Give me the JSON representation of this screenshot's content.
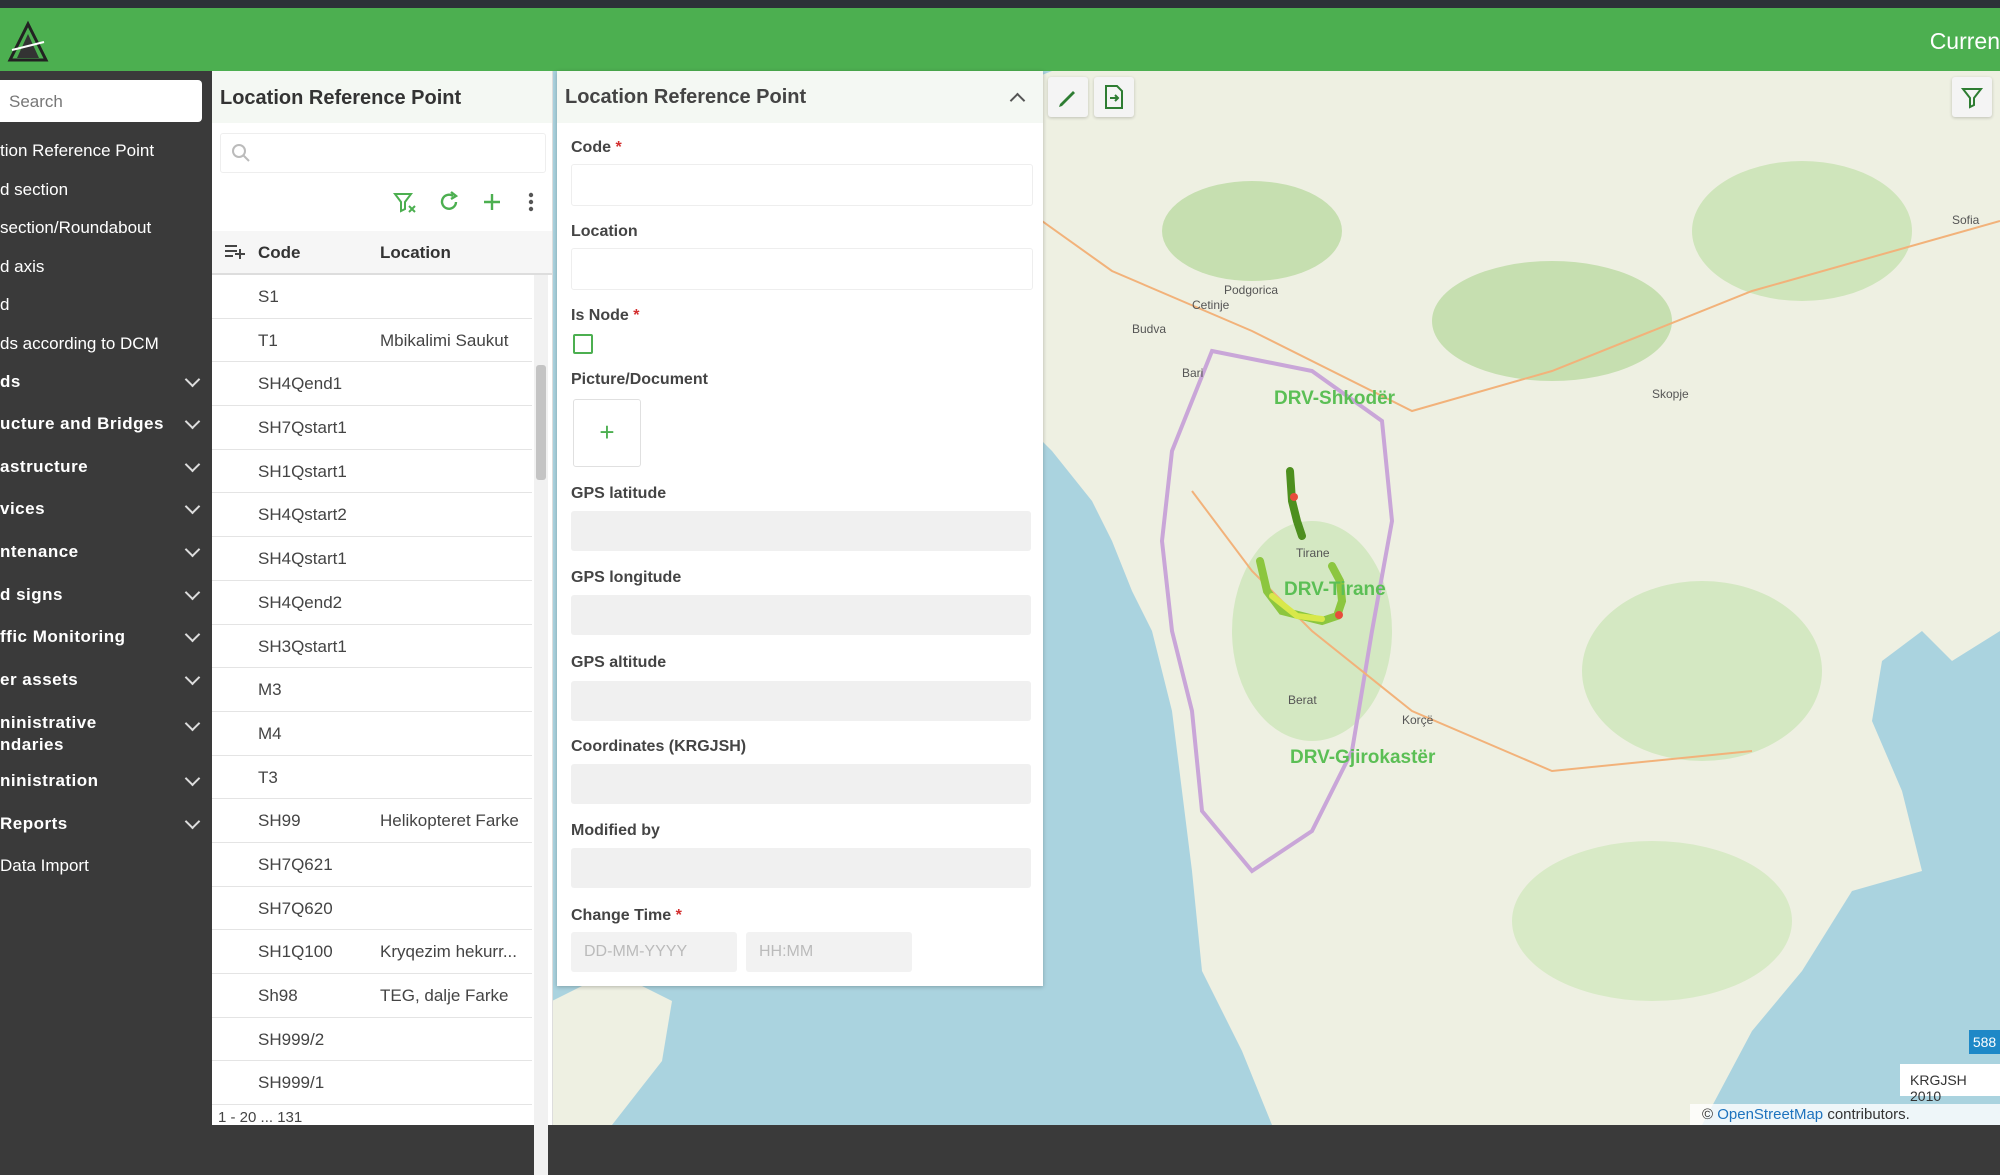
{
  "header": {
    "right_text": "Curren"
  },
  "sidebar": {
    "search_placeholder": "Search",
    "items": [
      {
        "label": "tion Reference Point",
        "group": false
      },
      {
        "label": "d section",
        "group": false
      },
      {
        "label": "section/Roundabout",
        "group": false
      },
      {
        "label": "d axis",
        "group": false
      },
      {
        "label": "d",
        "group": false
      },
      {
        "label": "ds according to DCM",
        "group": false
      },
      {
        "label": "ds",
        "group": true
      },
      {
        "label": "ucture and Bridges",
        "group": true
      },
      {
        "label": "astructure",
        "group": true
      },
      {
        "label": "vices",
        "group": true
      },
      {
        "label": "ntenance",
        "group": true
      },
      {
        "label": "d signs",
        "group": true
      },
      {
        "label": "ffic Monitoring",
        "group": true
      },
      {
        "label": "er assets",
        "group": true
      },
      {
        "label": "ninistrative\nndaries",
        "group": true
      },
      {
        "label": "ninistration",
        "group": true
      },
      {
        "label": "Reports",
        "group": true
      },
      {
        "label": "Data Import",
        "group": false
      }
    ]
  },
  "list": {
    "title": "Location Reference Point",
    "columns": {
      "code": "Code",
      "location": "Location"
    },
    "rows": [
      {
        "code": "S1",
        "location": ""
      },
      {
        "code": "T1",
        "location": "Mbikalimi Saukut"
      },
      {
        "code": "SH4Qend1",
        "location": ""
      },
      {
        "code": "SH7Qstart1",
        "location": ""
      },
      {
        "code": "SH1Qstart1",
        "location": ""
      },
      {
        "code": "SH4Qstart2",
        "location": ""
      },
      {
        "code": "SH4Qstart1",
        "location": ""
      },
      {
        "code": "SH4Qend2",
        "location": ""
      },
      {
        "code": "SH3Qstart1",
        "location": ""
      },
      {
        "code": "M3",
        "location": ""
      },
      {
        "code": "M4",
        "location": ""
      },
      {
        "code": "T3",
        "location": ""
      },
      {
        "code": "SH99",
        "location": "Helikopteret Farke"
      },
      {
        "code": "SH7Q621",
        "location": ""
      },
      {
        "code": "SH7Q620",
        "location": ""
      },
      {
        "code": "SH1Q100",
        "location": "Kryqezim hekurr..."
      },
      {
        "code": "Sh98",
        "location": "TEG, dalje Farke"
      },
      {
        "code": "SH999/2",
        "location": ""
      },
      {
        "code": "SH999/1",
        "location": ""
      }
    ],
    "pager": "1 - 20 ... 131"
  },
  "form": {
    "title": "Location Reference Point",
    "code_label": "Code",
    "location_label": "Location",
    "is_node_label": "Is Node",
    "picture_label": "Picture/Document",
    "add_symbol": "+",
    "gps_lat_label": "GPS latitude",
    "gps_lon_label": "GPS longitude",
    "gps_alt_label": "GPS altitude",
    "coords_label": "Coordinates (KRGJSH)",
    "modified_label": "Modified by",
    "change_time_label": "Change Time",
    "date_placeholder": "DD-MM-YYYY",
    "time_placeholder": "HH:MM",
    "required_mark": "*"
  },
  "map": {
    "regions": [
      "DRV-Shkodër",
      "DRV-Tirane",
      "DRV-Gjirokastër"
    ],
    "places": [
      "Podgorica",
      "Tirane",
      "Skopje",
      "Sofia",
      "Berat",
      "Korçë",
      "Cetinje",
      "Budva",
      "Bari"
    ],
    "crs_label": "KRGJSH 2010",
    "scale_badge": "588",
    "attribution_prefix": "©",
    "attribution_link": "OpenStreetMap",
    "attribution_suffix": "contributors."
  },
  "colors": {
    "brand_green": "#4caf50",
    "sidebar_bg": "#3a3a3a",
    "required_red": "#d32f2f",
    "sea": "#aad3df",
    "land": "#eef0e2"
  }
}
